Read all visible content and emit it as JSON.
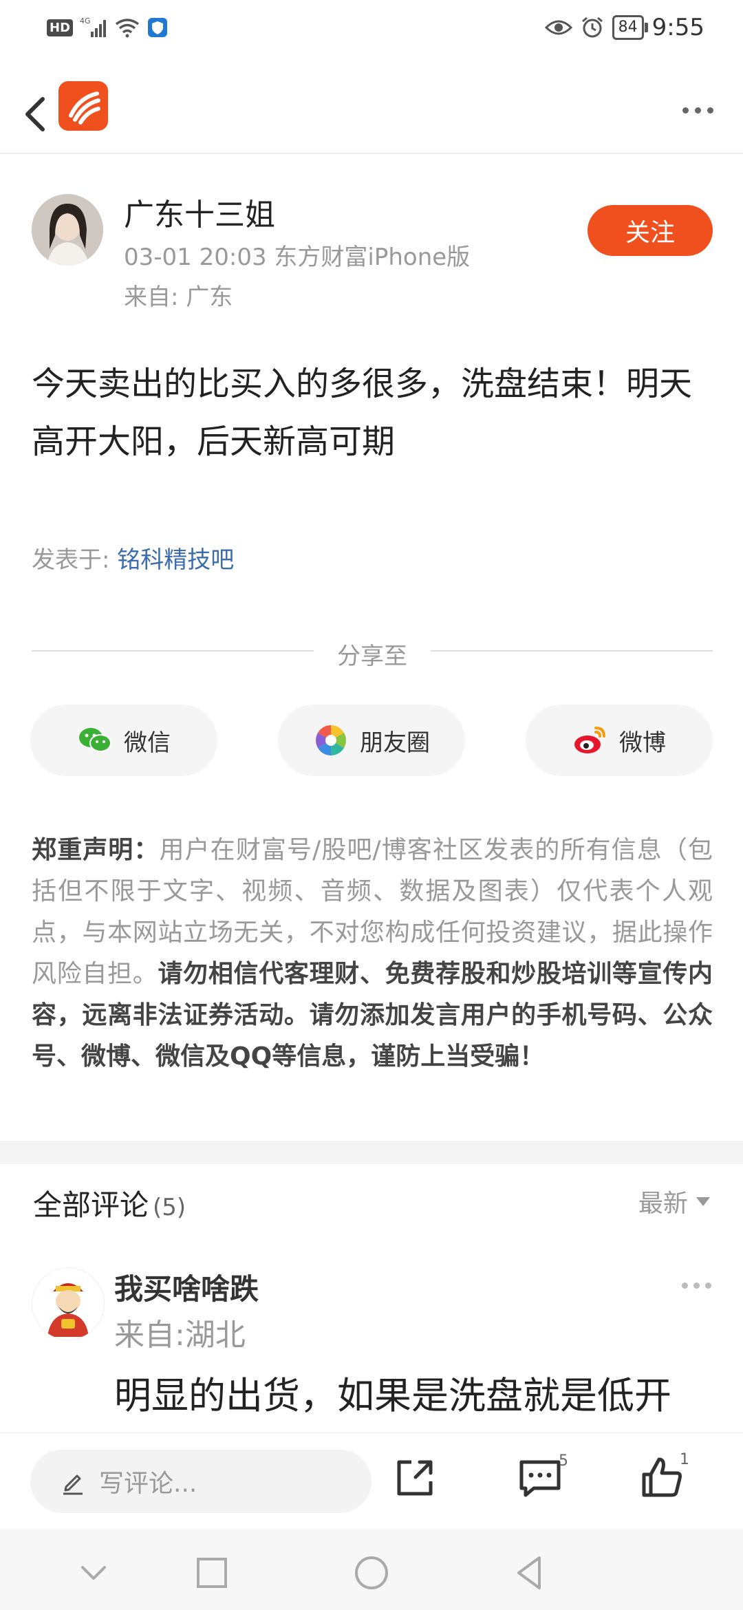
{
  "status_bar": {
    "network": "4G",
    "battery": "84",
    "time": "9:55"
  },
  "author": {
    "name": "广东十三姐",
    "meta": "03-01 20:03 东方财富iPhone版",
    "from": "来自: 广东",
    "follow_label": "关注"
  },
  "post": {
    "text": "今天卖出的比买入的多很多，洗盘结束！明天高开大阳，后天新高可期",
    "posted_in_label": "发表于: ",
    "bar_name": "铭科精技吧"
  },
  "share": {
    "title": "分享至",
    "items": [
      "微信",
      "朋友圈",
      "微博"
    ]
  },
  "disclaimer": {
    "label": "郑重声明",
    "colon": "：",
    "normal": "用户在财富号/股吧/博客社区发表的所有信息（包括但不限于文字、视频、音频、数据及图表）仅代表个人观点，与本网站立场无关，不对您构成任何投资建议，据此操作风险自担。",
    "strong": "请勿相信代客理财、免费荐股和炒股培训等宣传内容，远离非法证券活动。请勿添加发言用户的手机号码、公众号、微博、微信及QQ等信息，谨防上当受骗！"
  },
  "comments": {
    "title": "全部评论",
    "count": "(5)",
    "sort_label": "最新",
    "items": [
      {
        "name": "我买啥啥跌",
        "from": "来自:湖北",
        "text": "明显的出货，如果是洗盘就是低开"
      }
    ]
  },
  "bottom_bar": {
    "placeholder": "写评论...",
    "comment_count": "5",
    "like_count": "1"
  },
  "colors": {
    "accent": "#f0501d",
    "link": "#3b6cad"
  }
}
